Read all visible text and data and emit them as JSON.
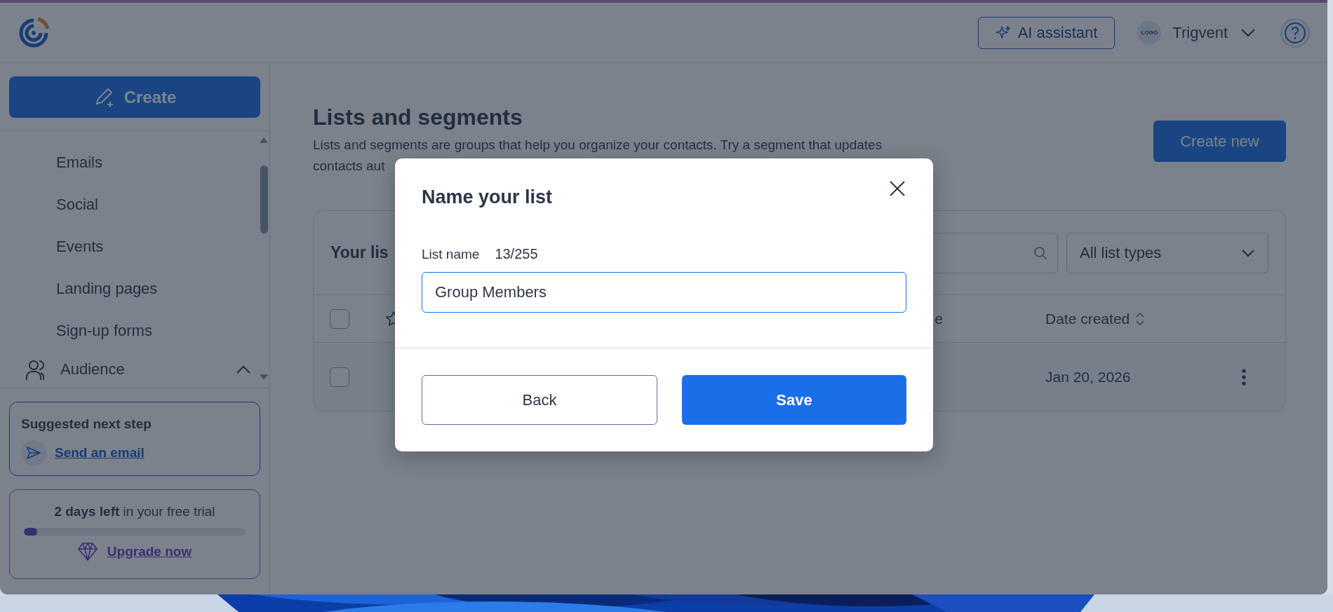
{
  "topbar": {
    "ai_button": "AI assistant",
    "account": {
      "avatar": "LOGO",
      "name": "Trigvent"
    }
  },
  "sidebar": {
    "create_button": "Create",
    "nav_items": [
      {
        "label": "Emails",
        "kind": "subitem"
      },
      {
        "label": "Social",
        "kind": "subitem"
      },
      {
        "label": "Events",
        "kind": "subitem"
      },
      {
        "label": "Landing pages",
        "kind": "subitem"
      },
      {
        "label": "Sign-up forms",
        "kind": "subitem"
      },
      {
        "label": "Audience",
        "kind": "section",
        "expanded": true
      }
    ],
    "suggestion": {
      "heading": "Suggested next step",
      "link": "Send an email"
    },
    "trial": {
      "message": "**2 days left** in your free trial",
      "level": 0.06,
      "link": "Upgrade now"
    }
  },
  "page": {
    "title": "Lists and segments",
    "description": [
      "Lists and segments are groups that help you organize your contacts. Try a segment that updates",
      "contacts aut"
    ],
    "create_button": "Create new",
    "card": {
      "title": "Your lis",
      "filter": "All list types",
      "select_all_checked": false,
      "columns": [
        {
          "label": "e"
        },
        {
          "label": "Date created"
        }
      ],
      "rows": [
        {
          "checked": false,
          "date_created": "Jan 20, 2026"
        }
      ]
    }
  },
  "modal": {
    "title": "Name your list",
    "field_label": "List name",
    "counter": "13/255",
    "value": "Group Members",
    "buttons": [
      {
        "label": "Back",
        "kind": "secondary"
      },
      {
        "label": "Save",
        "kind": "primary"
      }
    ]
  }
}
